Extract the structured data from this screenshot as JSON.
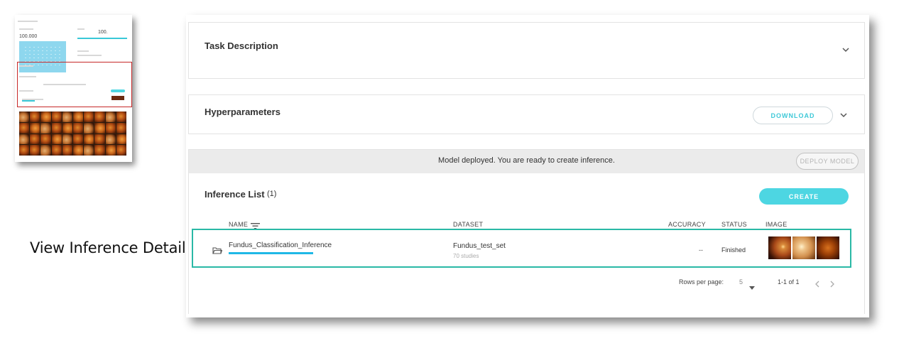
{
  "caption": "View Inference Detail",
  "task_description": {
    "title": "Task Description"
  },
  "hyperparameters": {
    "title": "Hyperparameters",
    "download_label": "DOWNLOAD"
  },
  "banner": {
    "message": "Model deployed. You are ready to create inference.",
    "deploy_label": "DEPLOY MODEL"
  },
  "inference_list": {
    "title": "Inference List",
    "count": "(1)",
    "create_label": "CREATE",
    "columns": {
      "name": "NAME",
      "dataset": "DATASET",
      "accuracy": "ACCURACY",
      "status": "STATUS",
      "image": "IMAGE"
    },
    "rows": [
      {
        "name": "Fundus_Classification_Inference",
        "dataset": "Fundus_test_set",
        "dataset_sub": "70 studies",
        "accuracy": "--",
        "status": "Finished"
      }
    ]
  },
  "pagination": {
    "rows_per_page_label": "Rows per page:",
    "rows_per_page_value": "5",
    "range": "1-1 of 1"
  },
  "thumbnail": {
    "header_value": "100.000",
    "slider_value": "100."
  },
  "colors": {
    "accent": "#4dd6e2",
    "highlight_border": "#2ab9a6",
    "progress": "#1fb8e6",
    "thumbnail_selection": "#c62828"
  },
  "icons": [
    "chevron-down-icon",
    "filter-list-icon",
    "folder-open-icon",
    "chevron-left-icon",
    "chevron-right-icon",
    "caret-down-icon"
  ]
}
